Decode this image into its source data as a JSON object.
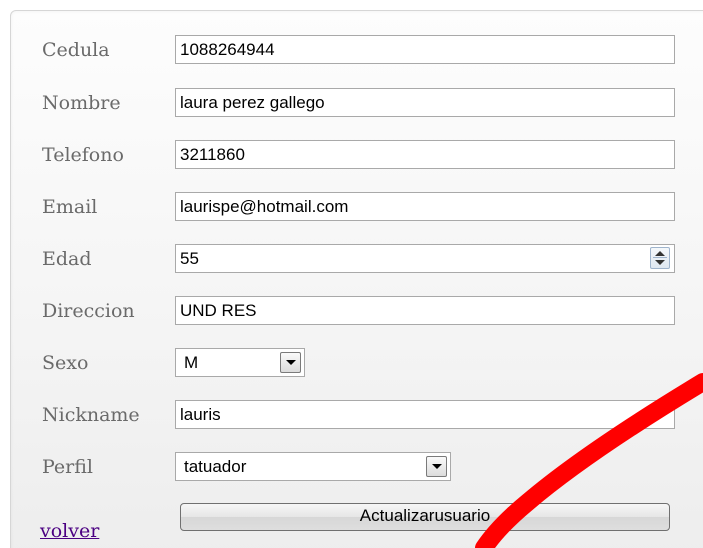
{
  "form": {
    "fields": [
      {
        "label": "Cedula",
        "value": "1088264944"
      },
      {
        "label": "Nombre",
        "value": "laura perez gallego"
      },
      {
        "label": "Telefono",
        "value": "3211860"
      },
      {
        "label": "Email",
        "value": "laurispe@hotmail.com"
      },
      {
        "label": "Edad",
        "value": "55"
      },
      {
        "label": "Direccion",
        "value": "UND RES"
      },
      {
        "label": "Sexo",
        "value": "M"
      },
      {
        "label": "Nickname",
        "value": "lauris"
      },
      {
        "label": "Perfil",
        "value": "tatuador"
      }
    ],
    "back_link": "volver",
    "submit_label": "Actualizarusuario"
  },
  "annotation": {
    "color": "#ff0000",
    "icon": "red-arrow-icon"
  }
}
